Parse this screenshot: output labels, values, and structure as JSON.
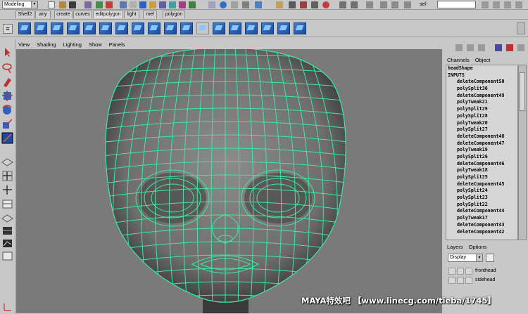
{
  "statusline": {
    "mode": "Modeling",
    "select_label": "sel-"
  },
  "shelf": {
    "tabs": [
      "Shelf2",
      "any",
      "create",
      "curves",
      "editpolygon",
      "light",
      "mel",
      "polygon"
    ],
    "active_tab": "editpolygon"
  },
  "viewport": {
    "menus": [
      "View",
      "Shading",
      "Lighting",
      "Show",
      "Panels"
    ],
    "wire_color": "#3ee8a4"
  },
  "channel_box": {
    "tabs": [
      "Channels",
      "Object"
    ],
    "node": "headShape",
    "inputs_label": "INPUTS",
    "inputs": [
      "deleteComponent50",
      "polySplit30",
      "deleteComponent49",
      "polyTweak21",
      "polySplit29",
      "polySplit28",
      "polyTweak20",
      "polySplit27",
      "deleteComponent48",
      "deleteComponent47",
      "polyTweak19",
      "polySplit26",
      "deleteComponent46",
      "polyTweak18",
      "polySplit25",
      "deleteComponent45",
      "polySplit24",
      "polySplit23",
      "polySplit22",
      "deleteComponent44",
      "polyTweak17",
      "deleteComponent43",
      "deleteComponent42"
    ]
  },
  "layers": {
    "tabs": [
      "Layers",
      "Options"
    ],
    "display": "Display",
    "items": [
      "fronthead",
      "sidehead"
    ]
  },
  "watermark": "MAYA特效吧 【www.linecg.com/tieba/1745】"
}
